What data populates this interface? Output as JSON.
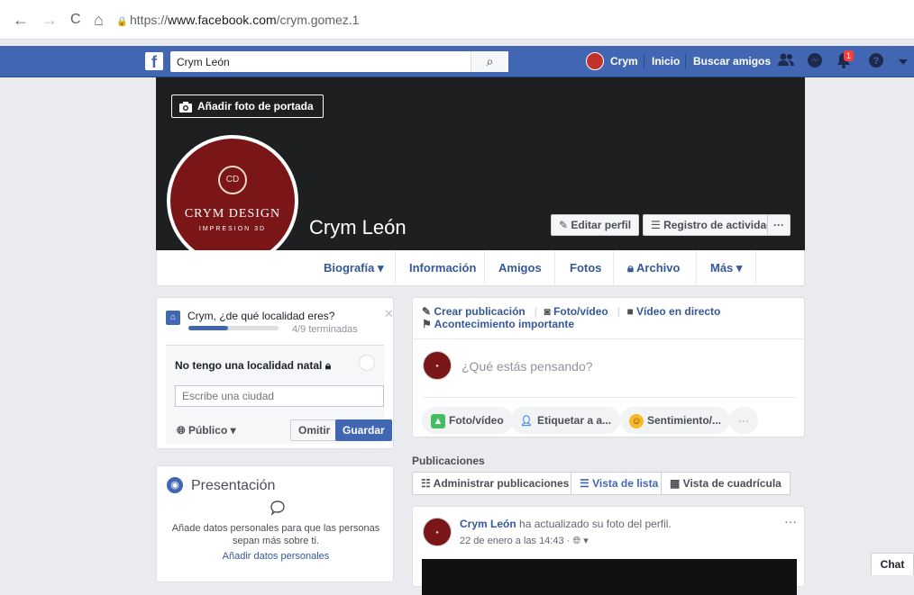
{
  "browser": {
    "back_icon": "←",
    "forward_icon": "→",
    "reload_icon": "C",
    "home_icon": "⌂",
    "lock_icon": "🔒",
    "url_prefix": "https://",
    "url_domain": "www.facebook.com",
    "url_path": "/crym.gomez.1"
  },
  "fbbar": {
    "logo": "f",
    "search_value": "Crym León",
    "search_icon": "⌕",
    "user_name": "Crym",
    "home_label": "Inicio",
    "find_friends_label": "Buscar amigos",
    "notif_count": "1"
  },
  "cover": {
    "add_cover_label": "Añadir foto de portada",
    "profile_name": "Crym León",
    "avatar_emblem": "CD",
    "avatar_brand": "CRYM DESIGN",
    "avatar_sub": "IMPRESION 3D",
    "edit_profile_label": "Editar perfil",
    "activity_log_label": "Registro de actividad",
    "more_dots": "···"
  },
  "tabs": {
    "biography": "Biografía ▾",
    "info": "Información",
    "friends": "Amigos",
    "photos": "Fotos",
    "archive": "Archivo",
    "more": "Más ▾"
  },
  "location_card": {
    "question": "Crym, ¿de qué localidad eres?",
    "progress_text": "4/9 terminadas",
    "progress_fraction": 0.44,
    "no_home_label": "No tengo una localidad natal",
    "city_placeholder": "Escribe una ciudad",
    "privacy_label": "Público ▾",
    "omit_label": "Omitir",
    "save_label": "Guardar"
  },
  "intro_card": {
    "title": "Presentación",
    "text": "Añade datos personales para que las personas sepan más sobre ti.",
    "link": "Añadir datos personales"
  },
  "composer": {
    "create_post": "Crear publicación",
    "photo_video": "Foto/vídeo",
    "live_video": "Vídeo en directo",
    "life_event": "Acontecimiento importante",
    "prompt": "¿Qué estás pensando?",
    "pill_photo": "Foto/vídeo",
    "pill_tag": "Etiquetar a a...",
    "pill_feeling": "Sentimiento/...",
    "pill_more": "···"
  },
  "posts": {
    "header": "Publicaciones",
    "manage_label": "Administrar publicaciones",
    "list_view_label": "Vista de lista",
    "grid_view_label": "Vista de cuadrícula"
  },
  "post": {
    "author": "Crym León",
    "action": " ha actualizado su foto del perfil.",
    "date": "22 de enero a las 14:43 · ",
    "dots": "···"
  },
  "chat": {
    "label": "Chat"
  },
  "colors": {
    "fb_blue": "#4267b2",
    "link_blue": "#365899",
    "avatar_red": "#7b1618",
    "cover_dark": "#1e1f21"
  }
}
